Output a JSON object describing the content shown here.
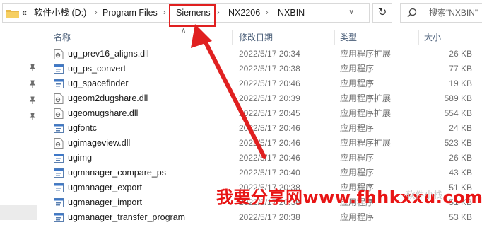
{
  "address_bar": {
    "overflow_label": "«",
    "breadcrumbs": [
      "软件小栈 (D:)",
      "Program Files",
      "Siemens",
      "NX2206",
      "NXBIN"
    ],
    "separator": "›",
    "dropdown_icon": "chevron-down-icon",
    "refresh_icon": "refresh-icon"
  },
  "search": {
    "placeholder": "搜索\"NXBIN\"",
    "icon": "search-icon"
  },
  "columns": {
    "name": "名称",
    "date": "修改日期",
    "type": "类型",
    "size": "大小"
  },
  "files": [
    {
      "name": "ug_prev16_aligns.dll",
      "date": "2022/5/17 20:34",
      "type": "应用程序扩展",
      "size": "26 KB",
      "icon": "dll-file-icon"
    },
    {
      "name": "ug_ps_convert",
      "date": "2022/5/17 20:38",
      "type": "应用程序",
      "size": "77 KB",
      "icon": "exe-file-icon"
    },
    {
      "name": "ug_spacefinder",
      "date": "2022/5/17 20:46",
      "type": "应用程序",
      "size": "19 KB",
      "icon": "exe-file-icon"
    },
    {
      "name": "ugeom2dugshare.dll",
      "date": "2022/5/17 20:39",
      "type": "应用程序扩展",
      "size": "589 KB",
      "icon": "dll-file-icon"
    },
    {
      "name": "ugeomugshare.dll",
      "date": "2022/5/17 20:45",
      "type": "应用程序扩展",
      "size": "554 KB",
      "icon": "dll-file-icon"
    },
    {
      "name": "ugfontc",
      "date": "2022/5/17 20:46",
      "type": "应用程序",
      "size": "24 KB",
      "icon": "exe-file-icon"
    },
    {
      "name": "ugimageview.dll",
      "date": "2022/5/17 20:46",
      "type": "应用程序扩展",
      "size": "523 KB",
      "icon": "dll-file-icon"
    },
    {
      "name": "ugimg",
      "date": "2022/5/17 20:46",
      "type": "应用程序",
      "size": "26 KB",
      "icon": "exe-file-icon"
    },
    {
      "name": "ugmanager_compare_ps",
      "date": "2022/5/17 20:40",
      "type": "应用程序",
      "size": "43 KB",
      "icon": "exe-file-icon"
    },
    {
      "name": "ugmanager_export",
      "date": "2022/5/17 20:38",
      "type": "应用程序",
      "size": "51 KB",
      "icon": "exe-file-icon"
    },
    {
      "name": "ugmanager_import",
      "date": "2022/5/17 20:38",
      "type": "应用程序",
      "size": "51 KB",
      "icon": "exe-file-icon"
    },
    {
      "name": "ugmanager_transfer_program",
      "date": "2022/5/17 20:38",
      "type": "应用程序",
      "size": "53 KB",
      "icon": "exe-file-icon"
    }
  ],
  "annotation": {
    "highlight_color": "#e02020",
    "watermark_text": "我要分享网www.fhhkxxu.com",
    "faint_text": "·软件小栈"
  }
}
